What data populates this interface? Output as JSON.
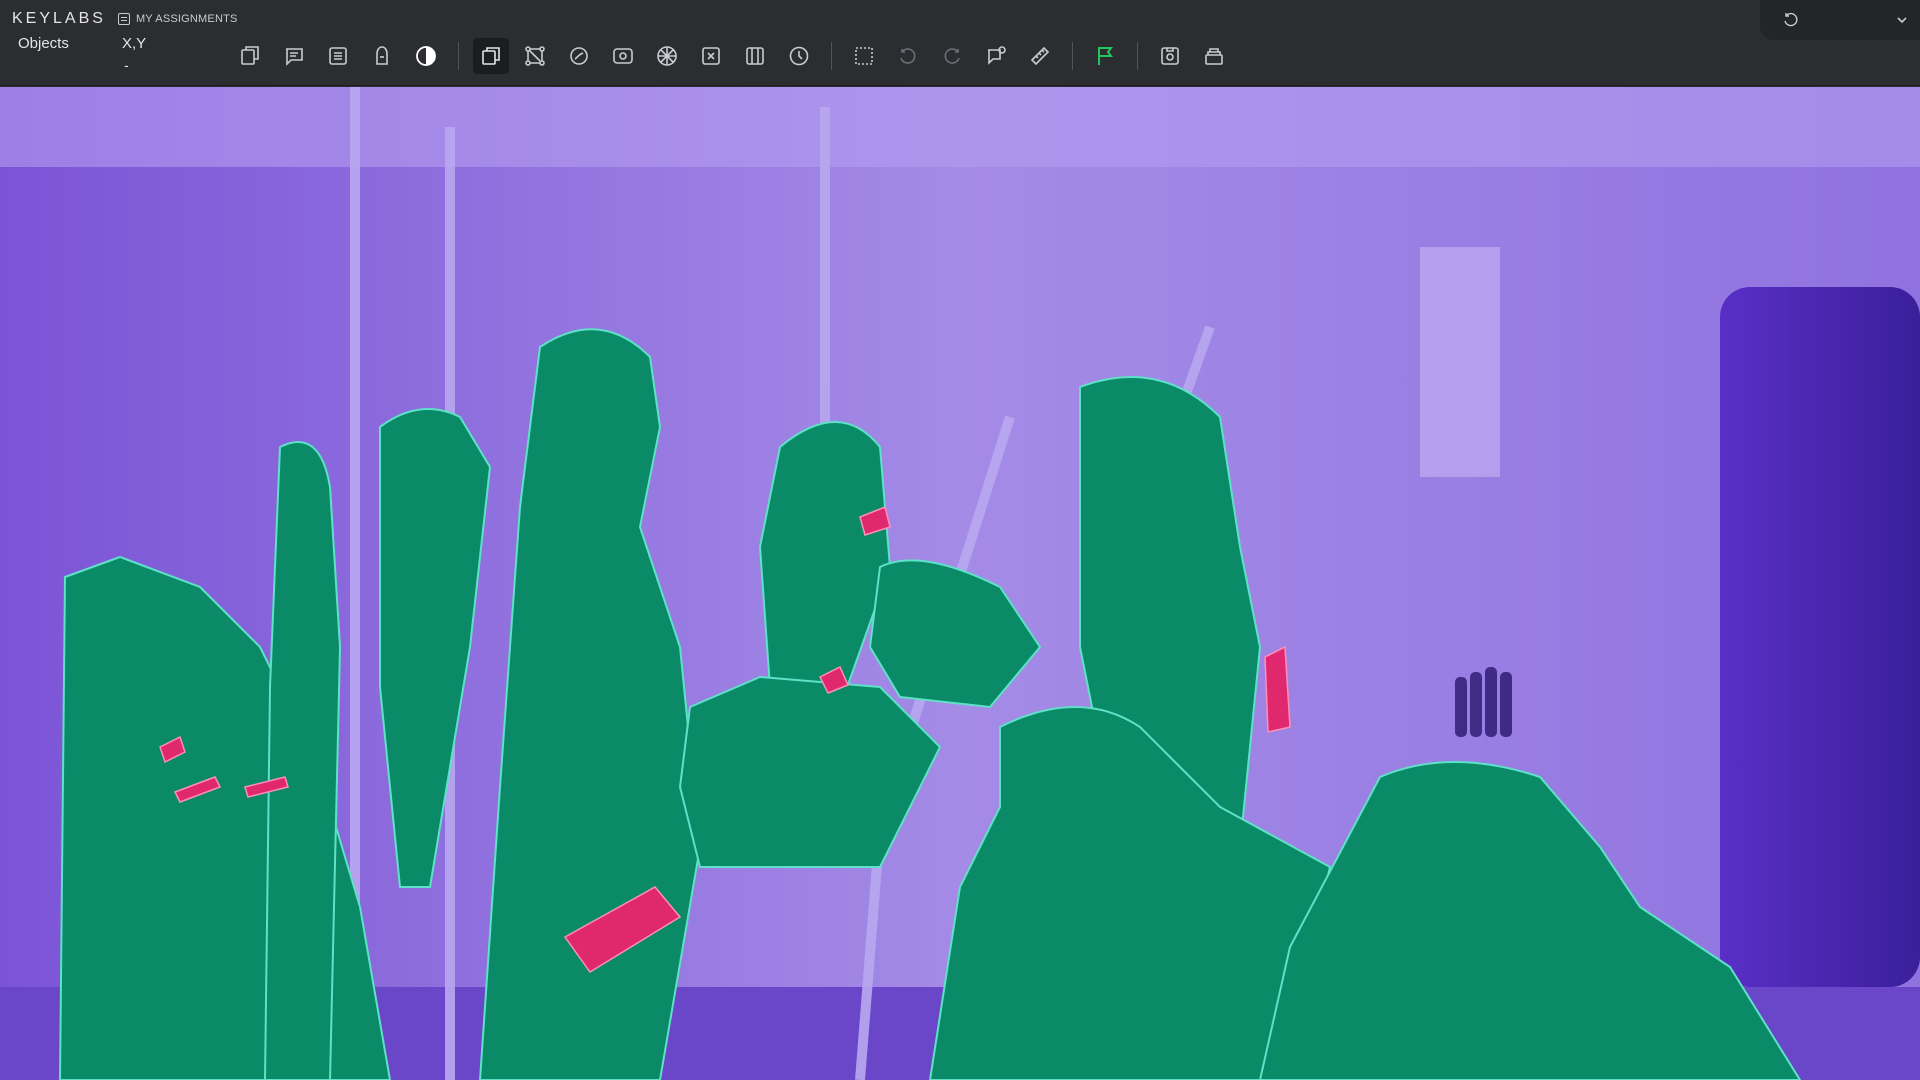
{
  "app": {
    "logo_text": "KEYLABS",
    "assignments_label": "MY ASSIGNMENTS"
  },
  "panel": {
    "objects_label": "Objects",
    "coord_label": "X,Y",
    "coord_value": "-"
  },
  "toolbar": {
    "tools": [
      "rectangle-tool-icon",
      "comment-tool-icon",
      "list-tool-icon",
      "brush-mask-icon",
      "contrast-icon",
      "copy-layer-icon",
      "polygon-points-icon",
      "smart-segment-icon",
      "auto-annotate-icon",
      "mesh-icon",
      "magic-select-icon",
      "grid-split-icon",
      "timer-icon",
      "selection-icon",
      "undo-icon",
      "redo-icon",
      "feedback-icon",
      "ruler-icon",
      "flag-icon",
      "screenshot-icon",
      "stack-icon"
    ],
    "accent_color": "#22c55e"
  },
  "image": {
    "subject": "subway car interior with segmented passengers",
    "mask_colors": {
      "background": "#8e6ad8",
      "person": "#0b8a68",
      "phone": "#e0286e",
      "outline": "#5fe0c8"
    }
  }
}
